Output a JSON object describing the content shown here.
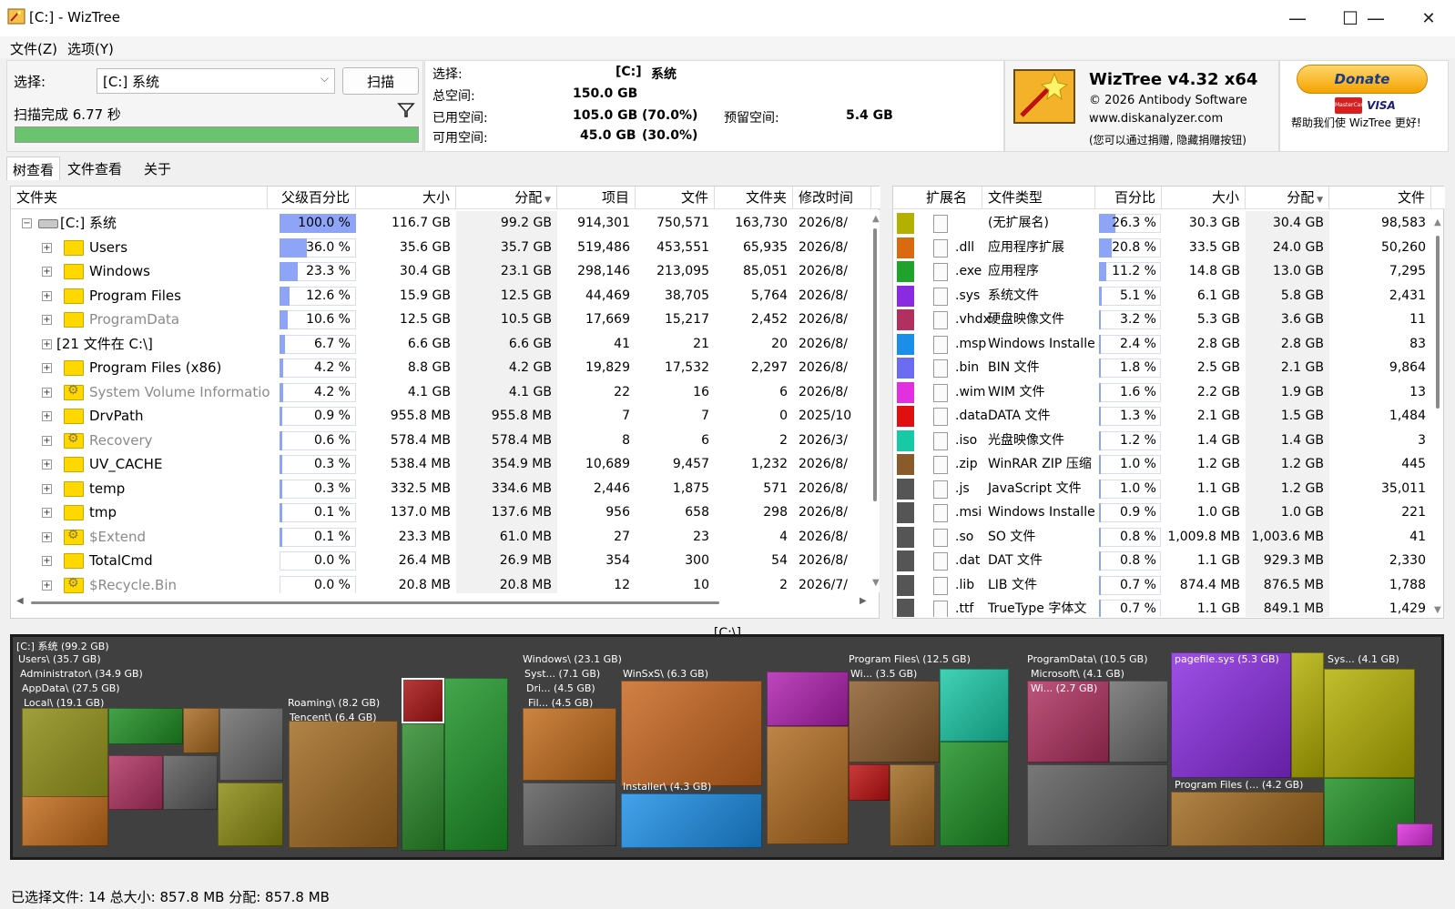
{
  "window": {
    "title": "[C:]  - WizTree",
    "minimize": "—",
    "maximize": "☐",
    "close": "✕"
  },
  "menu": [
    "文件(Z)",
    "选项(Y)"
  ],
  "scan_panel": {
    "select_label": "选择:",
    "drive_value": "[C:] 系统",
    "scan_button": "扫描",
    "status": "扫描完成 6.77 秒",
    "progress": 1.0
  },
  "drive_info": {
    "select_label": "选择:",
    "select_value": "[C:]",
    "select_name": "系统",
    "total_label": "总空间:",
    "total_value": "150.0 GB",
    "used_label": "已用空间:",
    "used_value": "105.0 GB",
    "used_pct": "(70.0%)",
    "reserved_label": "预留空间:",
    "reserved_value": "5.4 GB",
    "free_label": "可用空间:",
    "free_value": "45.0 GB",
    "free_pct": "(30.0%)"
  },
  "about": {
    "product": "WizTree v4.32 x64",
    "copyright": "© 2026 Antibody Software",
    "website": "www.diskanalyzer.com",
    "note": "(您可以通过捐赠, 隐藏捐赠按钮)"
  },
  "donate": {
    "button": "Donate",
    "card1": "MasterCard",
    "card2": "VISA",
    "text": "帮助我们使 WizTree 更好!"
  },
  "tabs": [
    "树查看",
    "文件查看",
    "关于"
  ],
  "tree": {
    "columns": [
      "文件夹",
      "父级百分比",
      "大小",
      "分配",
      "项目",
      "文件",
      "文件夹",
      "修改时间"
    ],
    "rows": [
      {
        "name": "[C:] 系统",
        "pct": "100.0 %",
        "pct_value": 100.0,
        "size": "116.7 GB",
        "alloc": "99.2 GB",
        "items": "914,301",
        "files": "750,571",
        "folders": "163,730",
        "modified": "2026/8/",
        "root": true,
        "gray": false
      },
      {
        "name": "Users",
        "pct": "36.0 %",
        "pct_value": 36.0,
        "size": "35.6 GB",
        "alloc": "35.7 GB",
        "items": "519,486",
        "files": "453,551",
        "folders": "65,935",
        "modified": "2026/8/",
        "gray": false
      },
      {
        "name": "Windows",
        "pct": "23.3 %",
        "pct_value": 23.3,
        "size": "30.4 GB",
        "alloc": "23.1 GB",
        "items": "298,146",
        "files": "213,095",
        "folders": "85,051",
        "modified": "2026/8/",
        "gray": false
      },
      {
        "name": "Program Files",
        "pct": "12.6 %",
        "pct_value": 12.6,
        "size": "15.9 GB",
        "alloc": "12.5 GB",
        "items": "44,469",
        "files": "38,705",
        "folders": "5,764",
        "modified": "2026/8/",
        "gray": false
      },
      {
        "name": "ProgramData",
        "pct": "10.6 %",
        "pct_value": 10.6,
        "size": "12.5 GB",
        "alloc": "10.5 GB",
        "items": "17,669",
        "files": "15,217",
        "folders": "2,452",
        "modified": "2026/8/",
        "gray": true
      },
      {
        "name": "[21 文件在 C:\\]",
        "pct": "6.7 %",
        "pct_value": 6.7,
        "size": "6.6 GB",
        "alloc": "6.6 GB",
        "items": "41",
        "files": "21",
        "folders": "20",
        "modified": "2026/8/",
        "gray": false,
        "nofolder": true
      },
      {
        "name": "Program Files (x86)",
        "pct": "4.2 %",
        "pct_value": 4.2,
        "size": "8.8 GB",
        "alloc": "4.2 GB",
        "items": "19,829",
        "files": "17,532",
        "folders": "2,297",
        "modified": "2026/8/",
        "gray": false
      },
      {
        "name": "System Volume Information",
        "pct": "4.2 %",
        "pct_value": 4.2,
        "size": "4.1 GB",
        "alloc": "4.1 GB",
        "items": "22",
        "files": "16",
        "folders": "6",
        "modified": "2026/8/",
        "gray": true,
        "sys": true
      },
      {
        "name": "DrvPath",
        "pct": "0.9 %",
        "pct_value": 0.9,
        "size": "955.8 MB",
        "alloc": "955.8 MB",
        "items": "7",
        "files": "7",
        "folders": "0",
        "modified": "2025/10",
        "gray": false
      },
      {
        "name": "Recovery",
        "pct": "0.6 %",
        "pct_value": 0.6,
        "size": "578.4 MB",
        "alloc": "578.4 MB",
        "items": "8",
        "files": "6",
        "folders": "2",
        "modified": "2026/3/",
        "gray": true,
        "sys": true
      },
      {
        "name": "UV_CACHE",
        "pct": "0.3 %",
        "pct_value": 0.3,
        "size": "538.4 MB",
        "alloc": "354.9 MB",
        "items": "10,689",
        "files": "9,457",
        "folders": "1,232",
        "modified": "2026/8/",
        "gray": false
      },
      {
        "name": "temp",
        "pct": "0.3 %",
        "pct_value": 0.3,
        "size": "332.5 MB",
        "alloc": "334.6 MB",
        "items": "2,446",
        "files": "1,875",
        "folders": "571",
        "modified": "2026/8/",
        "gray": false
      },
      {
        "name": "tmp",
        "pct": "0.1 %",
        "pct_value": 0.1,
        "size": "137.0 MB",
        "alloc": "137.6 MB",
        "items": "956",
        "files": "658",
        "folders": "298",
        "modified": "2026/8/",
        "gray": false
      },
      {
        "name": "$Extend",
        "pct": "0.1 %",
        "pct_value": 0.1,
        "size": "23.3 MB",
        "alloc": "61.0 MB",
        "items": "27",
        "files": "23",
        "folders": "4",
        "modified": "2026/8/",
        "gray": true,
        "sys": true
      },
      {
        "name": "TotalCmd",
        "pct": "0.0 %",
        "pct_value": 0.0,
        "size": "26.4 MB",
        "alloc": "26.9 MB",
        "items": "354",
        "files": "300",
        "folders": "54",
        "modified": "2026/8/",
        "gray": false
      },
      {
        "name": "$Recycle.Bin",
        "pct": "0.0 %",
        "pct_value": 0.0,
        "size": "20.8 MB",
        "alloc": "20.8 MB",
        "items": "12",
        "files": "10",
        "folders": "2",
        "modified": "2026/7/",
        "gray": true,
        "sys": true
      }
    ]
  },
  "extensions": {
    "columns": [
      "扩展名",
      "文件类型",
      "百分比",
      "大小",
      "分配",
      "文件"
    ],
    "rows": [
      {
        "color": "#b4b000",
        "ext": "",
        "type": "(无扩展名)",
        "pct": "26.3 %",
        "pct_value": 26.3,
        "size": "30.3 GB",
        "alloc": "30.4 GB",
        "files": "98,583"
      },
      {
        "color": "#d96a10",
        "ext": ".dll",
        "type": "应用程序扩展",
        "pct": "20.8 %",
        "pct_value": 20.8,
        "size": "33.5 GB",
        "alloc": "24.0 GB",
        "files": "50,260"
      },
      {
        "color": "#1fa32a",
        "ext": ".exe",
        "type": "应用程序",
        "pct": "11.2 %",
        "pct_value": 11.2,
        "size": "14.8 GB",
        "alloc": "13.0 GB",
        "files": "7,295"
      },
      {
        "color": "#8a2be2",
        "ext": ".sys",
        "type": "系统文件",
        "pct": "5.1 %",
        "pct_value": 5.1,
        "size": "6.1 GB",
        "alloc": "5.8 GB",
        "files": "2,431"
      },
      {
        "color": "#b0305f",
        "ext": ".vhdx",
        "type": "硬盘映像文件",
        "pct": "3.2 %",
        "pct_value": 3.2,
        "size": "5.3 GB",
        "alloc": "3.6 GB",
        "files": "11"
      },
      {
        "color": "#1b8fe8",
        "ext": ".msp",
        "type": "Windows Installe",
        "pct": "2.4 %",
        "pct_value": 2.4,
        "size": "2.8 GB",
        "alloc": "2.8 GB",
        "files": "83"
      },
      {
        "color": "#6c6cf0",
        "ext": ".bin",
        "type": "BIN 文件",
        "pct": "1.8 %",
        "pct_value": 1.8,
        "size": "2.5 GB",
        "alloc": "2.1 GB",
        "files": "9,864"
      },
      {
        "color": "#e030e0",
        "ext": ".wim",
        "type": "WIM 文件",
        "pct": "1.6 %",
        "pct_value": 1.6,
        "size": "2.2 GB",
        "alloc": "1.9 GB",
        "files": "13"
      },
      {
        "color": "#e01010",
        "ext": ".data",
        "type": "DATA 文件",
        "pct": "1.3 %",
        "pct_value": 1.3,
        "size": "2.1 GB",
        "alloc": "1.5 GB",
        "files": "1,484"
      },
      {
        "color": "#18c9a6",
        "ext": ".iso",
        "type": "光盘映像文件",
        "pct": "1.2 %",
        "pct_value": 1.2,
        "size": "1.4 GB",
        "alloc": "1.4 GB",
        "files": "3"
      },
      {
        "color": "#8a5a2a",
        "ext": ".zip",
        "type": "WinRAR ZIP 压缩",
        "pct": "1.0 %",
        "pct_value": 1.0,
        "size": "1.2 GB",
        "alloc": "1.2 GB",
        "files": "445"
      },
      {
        "color": "#555555",
        "ext": ".js",
        "type": "JavaScript 文件",
        "pct": "1.0 %",
        "pct_value": 1.0,
        "size": "1.1 GB",
        "alloc": "1.2 GB",
        "files": "35,011"
      },
      {
        "color": "#555555",
        "ext": ".msi",
        "type": "Windows Installe",
        "pct": "0.9 %",
        "pct_value": 0.9,
        "size": "1.0 GB",
        "alloc": "1.0 GB",
        "files": "221"
      },
      {
        "color": "#555555",
        "ext": ".so",
        "type": "SO 文件",
        "pct": "0.8 %",
        "pct_value": 0.8,
        "size": "1,009.8 MB",
        "alloc": "1,003.6 MB",
        "files": "41"
      },
      {
        "color": "#555555",
        "ext": ".dat",
        "type": "DAT 文件",
        "pct": "0.8 %",
        "pct_value": 0.8,
        "size": "1.1 GB",
        "alloc": "929.3 MB",
        "files": "2,330"
      },
      {
        "color": "#555555",
        "ext": ".lib",
        "type": "LIB 文件",
        "pct": "0.7 %",
        "pct_value": 0.7,
        "size": "874.4 MB",
        "alloc": "876.5 MB",
        "files": "1,788"
      },
      {
        "color": "#555555",
        "ext": ".ttf",
        "type": "TrueType 字体文",
        "pct": "0.7 %",
        "pct_value": 0.7,
        "size": "1.1 GB",
        "alloc": "849.1 MB",
        "files": "1,429"
      }
    ]
  },
  "path_label": "[C:\\]",
  "treemap": {
    "labels": [
      "[C:] 系统  (99.2 GB)",
      "Users\\ (35.7 GB)",
      "Administrator\\ (34.9 GB)",
      "AppData\\ (27.5 GB)",
      "Local\\ (19.1 GB)",
      "Roaming\\ (8.2 GB)",
      "Tencent\\ (6.4 GB)",
      "Windows\\ (23.1 GB)",
      "Syst... (7.1 GB)",
      "Dri... (4.5 GB)",
      "Fil... (4.5 GB)",
      "WinSxS\\ (6.3 GB)",
      "Installer\\ (4.3 GB)",
      "Program Files\\ (12.5 GB)",
      "Wi... (3.5 GB)",
      "ProgramData\\ (10.5 GB)",
      "Microsoft\\ (4.1 GB)",
      "Wi... (2.7 GB)",
      "pagefile.sys (5.3 GB)",
      "Sys... (4.1 GB)",
      "Program Files (... (4.2 GB)"
    ]
  },
  "status_bar": "已选择文件: 14  总大小: 857.8 MB  分配: 857.8 MB"
}
